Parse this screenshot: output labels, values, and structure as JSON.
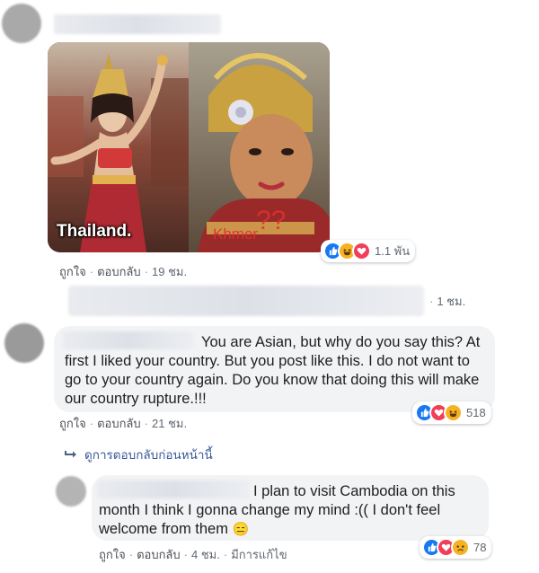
{
  "post_image": {
    "left_caption": "Thailand.",
    "right_caption": "Khmer",
    "right_mark": "??",
    "reactions": {
      "icons": [
        "like-icon",
        "haha-icon",
        "love-icon"
      ],
      "count": "1.1 พัน"
    }
  },
  "comment1_meta": {
    "like": "ถูกใจ",
    "reply": "ตอบกลับ",
    "time": "19 ชม."
  },
  "comment2": {
    "time": "1 ชม."
  },
  "comment3": {
    "text": "You are Asian, but why do you say this? At first I liked your country. But you post like this. I do not want to go to your country again. Do you know that doing this will make our country rupture.!!!",
    "meta": {
      "like": "ถูกใจ",
      "reply": "ตอบกลับ",
      "time": "21 ชม."
    },
    "reactions": {
      "icons": [
        "like-icon",
        "love-icon",
        "haha-icon"
      ],
      "count": "518"
    }
  },
  "view_previous": "ดูการตอบกลับก่อนหน้านี้",
  "comment4": {
    "text": "I plan to visit Cambodia on this month I think I gonna change my mind :(( I don't feel welcome from them",
    "emoji": "😑",
    "meta": {
      "like": "ถูกใจ",
      "reply": "ตอบกลับ",
      "time": "4 ชม.",
      "edited": "มีการแก้ไข"
    },
    "reactions": {
      "icons": [
        "like-icon",
        "love-icon",
        "sad-icon"
      ],
      "count": "78"
    }
  },
  "colors": {
    "like": "#1877f2",
    "love": "#f33e58",
    "haha": "#f7b125",
    "link": "#385898",
    "bubble": "#f2f3f5"
  }
}
